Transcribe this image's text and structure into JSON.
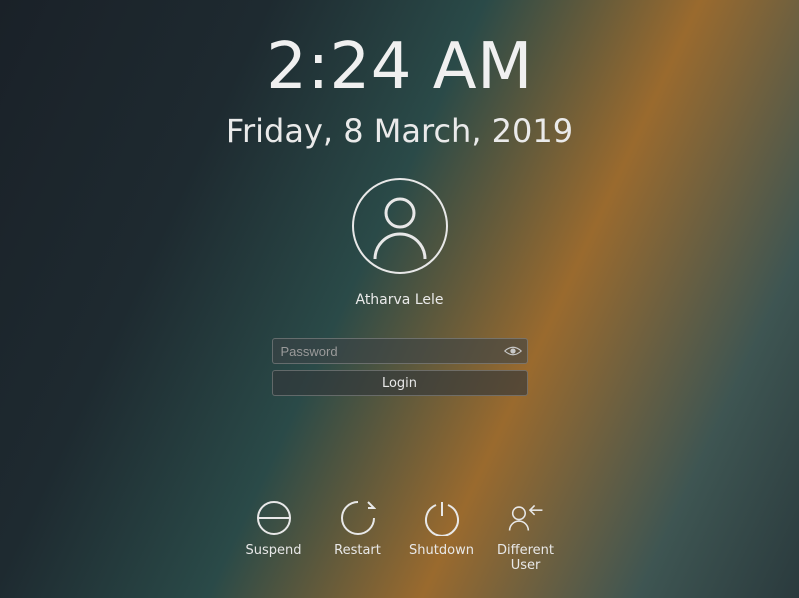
{
  "clock": {
    "time": "2:24 AM",
    "date": "Friday, 8 March, 2019"
  },
  "user": {
    "name": "Atharva Lele"
  },
  "login": {
    "password_placeholder": "Password",
    "button_label": "Login"
  },
  "actions": {
    "suspend": "Suspend",
    "restart": "Restart",
    "shutdown": "Shutdown",
    "different_user": "Different User"
  }
}
